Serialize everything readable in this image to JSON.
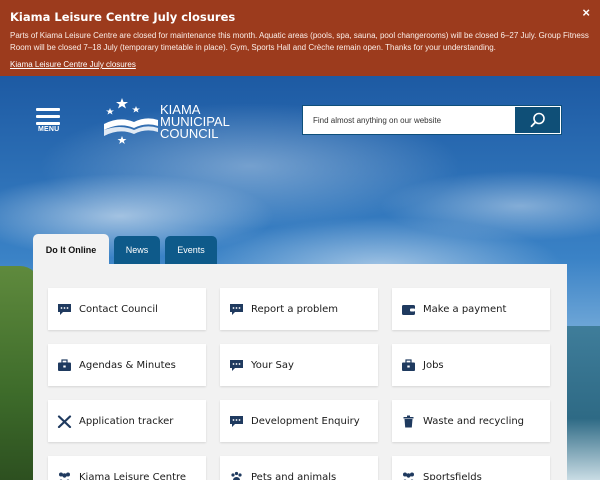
{
  "alert": {
    "title": "Kiama Leisure Centre July closures",
    "body": "Parts of Kiama Leisure Centre are closed for maintenance this month. Aquatic areas (pools, spa, sauna, pool changerooms) will be closed 6–27 July. Group Fitness Room will be closed 7–18 July (temporary timetable in place). Gym, Sports Hall and Crèche remain open. Thanks for your understanding.",
    "link": "Kiama Leisure Centre July closures",
    "close_icon": "×"
  },
  "header": {
    "menu_label": "MENU",
    "logo_lines": [
      "KIAMA",
      "MUNICIPAL",
      "COUNCIL"
    ],
    "search_placeholder": "Find almost anything on our website"
  },
  "tabs": [
    {
      "label": "Do It Online",
      "active": true
    },
    {
      "label": "News",
      "active": false
    },
    {
      "label": "Events",
      "active": false
    }
  ],
  "tiles": [
    {
      "label": "Contact Council",
      "icon": "speech-bubble-icon"
    },
    {
      "label": "Report a problem",
      "icon": "speech-bubble-icon"
    },
    {
      "label": "Make a payment",
      "icon": "wallet-icon"
    },
    {
      "label": "Agendas & Minutes",
      "icon": "briefcase-icon"
    },
    {
      "label": "Your Say",
      "icon": "speech-bubble-icon"
    },
    {
      "label": "Jobs",
      "icon": "briefcase-icon"
    },
    {
      "label": "Application tracker",
      "icon": "tools-icon"
    },
    {
      "label": "Development Enquiry",
      "icon": "speech-bubble-icon"
    },
    {
      "label": "Waste and recycling",
      "icon": "trash-icon"
    },
    {
      "label": "Kiama Leisure Centre",
      "icon": "people-icon"
    },
    {
      "label": "Pets and animals",
      "icon": "paw-icon"
    },
    {
      "label": "Sportsfields",
      "icon": "people-icon"
    }
  ],
  "colors": {
    "alert_bg": "#9c3b1d",
    "primary_blue": "#0e5a8a",
    "icon_navy": "#1f3a5f"
  }
}
